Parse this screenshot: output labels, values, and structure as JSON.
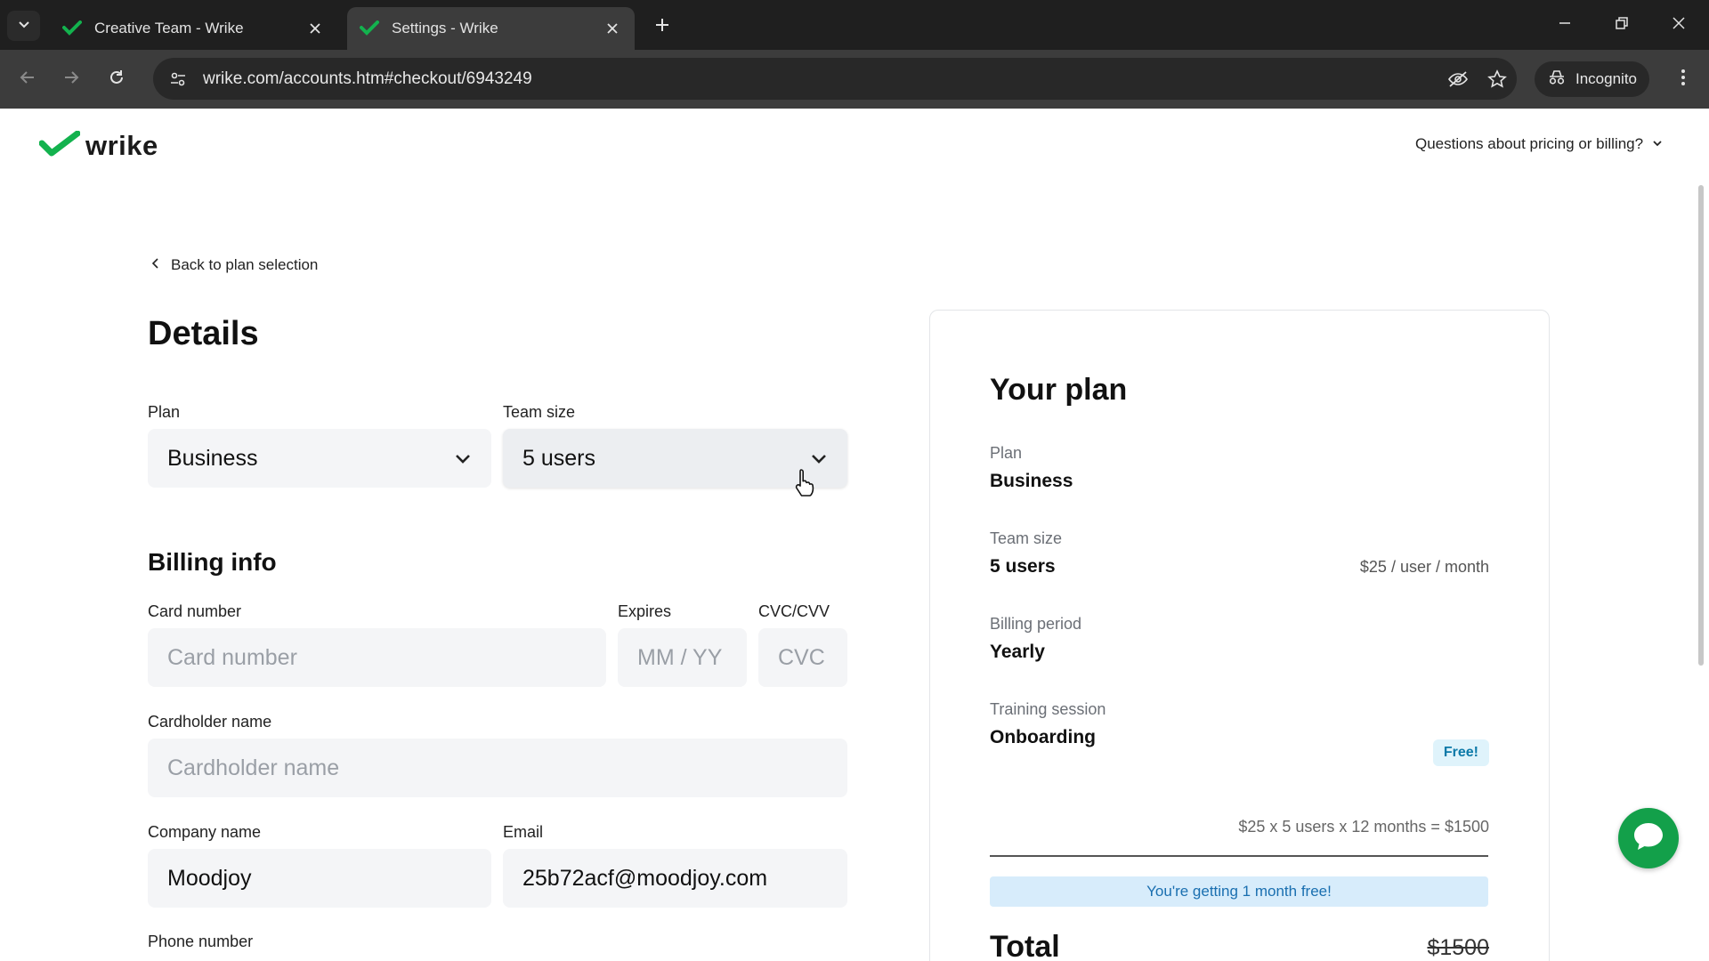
{
  "browser": {
    "tabs": [
      {
        "title": "Creative Team - Wrike",
        "active": false
      },
      {
        "title": "Settings - Wrike",
        "active": true
      }
    ],
    "url": "wrike.com/accounts.htm#checkout/6943249",
    "incognito_label": "Incognito"
  },
  "header": {
    "logo_text": "wrike",
    "help_link": "Questions about pricing or billing?"
  },
  "details": {
    "back_link": "Back to plan selection",
    "title": "Details",
    "plan_label": "Plan",
    "plan_value": "Business",
    "team_size_label": "Team size",
    "team_size_value": "5 users"
  },
  "billing": {
    "title": "Billing info",
    "card_number_label": "Card number",
    "card_number_placeholder": "Card number",
    "expires_label": "Expires",
    "expires_placeholder": "MM / YY",
    "cvc_label": "CVC/CVV",
    "cvc_placeholder": "CVC",
    "cardholder_label": "Cardholder name",
    "cardholder_placeholder": "Cardholder name",
    "company_label": "Company name",
    "company_value": "Moodjoy",
    "email_label": "Email",
    "email_value": "25b72acf@moodjoy.com",
    "phone_label": "Phone number"
  },
  "summary": {
    "title": "Your plan",
    "plan_label": "Plan",
    "plan_value": "Business",
    "team_label": "Team size",
    "team_value": "5 users",
    "team_price": "$25 / user / month",
    "period_label": "Billing period",
    "period_value": "Yearly",
    "training_label": "Training session",
    "training_value": "Onboarding",
    "training_badge": "Free!",
    "calculation": "$25 x 5 users x 12 months = $1500",
    "promo": "You're getting 1 month free!",
    "total_label": "Total",
    "total_old": "$1500"
  },
  "colors": {
    "brand_green": "#13a04a",
    "field_bg": "#f4f5f7",
    "promo_bg": "#d7ecfb",
    "chrome_dark": "#1f1f1f"
  }
}
